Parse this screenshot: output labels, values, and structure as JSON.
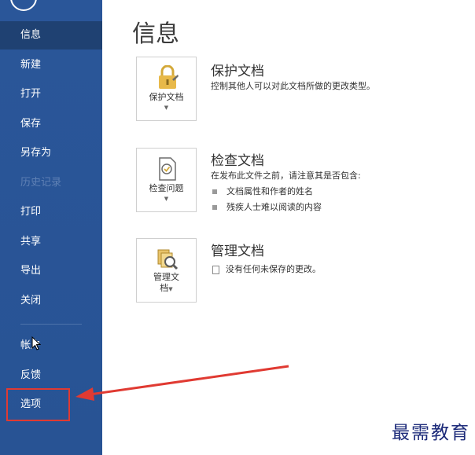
{
  "sidebar": {
    "items": [
      {
        "label": "信息"
      },
      {
        "label": "新建"
      },
      {
        "label": "打开"
      },
      {
        "label": "保存"
      },
      {
        "label": "另存为"
      },
      {
        "label": "历史记录"
      },
      {
        "label": "打印"
      },
      {
        "label": "共享"
      },
      {
        "label": "导出"
      },
      {
        "label": "关闭"
      },
      {
        "label": "帐户"
      },
      {
        "label": "反馈"
      },
      {
        "label": "选项"
      }
    ]
  },
  "main": {
    "title": "信息",
    "sections": [
      {
        "tile_label": "保护文档",
        "title": "保护文档",
        "description": "控制其他人可以对此文档所做的更改类型。"
      },
      {
        "tile_label": "检查问题",
        "title": "检查文档",
        "description": "在发布此文件之前，请注意其是否包含:",
        "bullets": [
          "文档属性和作者的姓名",
          "残疾人士难以阅读的内容"
        ]
      },
      {
        "tile_label_line1": "管理文",
        "tile_label_line2": "档",
        "title": "管理文档",
        "note": "没有任何未保存的更改。"
      }
    ]
  },
  "watermark": "最需教育",
  "colors": {
    "sidebar_bg": "#2b5797",
    "active_item": "#1f4172",
    "highlight_box": "#e03a32",
    "arrow": "#e03a32"
  }
}
